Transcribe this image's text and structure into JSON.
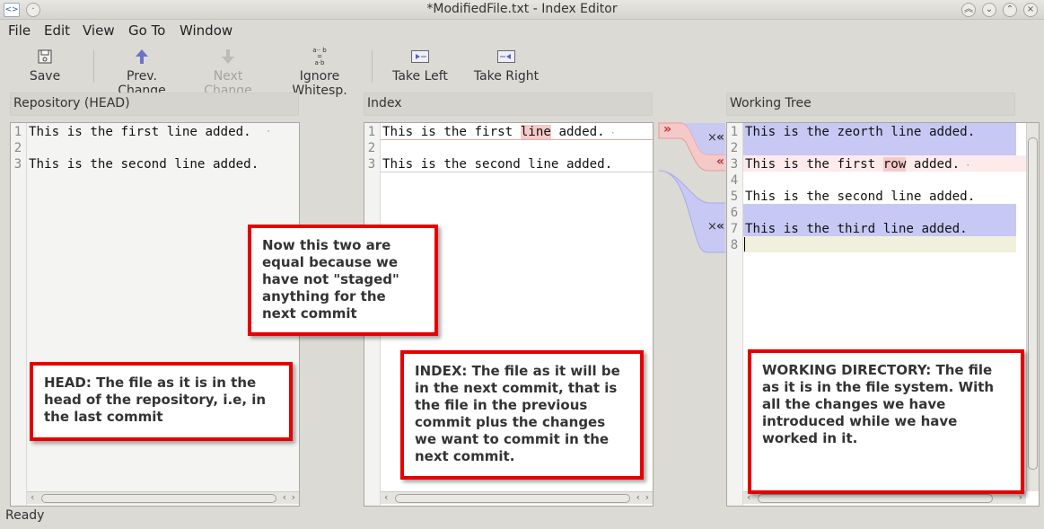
{
  "window": {
    "title": "*ModifiedFile.txt - Index Editor"
  },
  "menu": [
    "File",
    "Edit",
    "View",
    "Go To",
    "Window"
  ],
  "toolbar": {
    "save": "Save",
    "prev_change": "Prev. Change",
    "next_change": "Next Change",
    "ignore_ws": "Ignore Whitesp.",
    "ignore_ws_glyph_top": "a·· b",
    "ignore_ws_glyph_mid": "=",
    "ignore_ws_glyph_bot": "a·b",
    "take_left": "Take Left",
    "take_right": "Take Right"
  },
  "panes": {
    "repository": {
      "header": "Repository (HEAD)",
      "lines": [
        "This is the first line added.",
        "",
        "This is the second line added."
      ],
      "line_numbers": [
        "1",
        "2",
        "3"
      ]
    },
    "index": {
      "header": "Index",
      "line1_pre": "This is the first ",
      "line1_hl": "line",
      "line1_post": " added.",
      "line3": "This is the second line added.",
      "line_numbers": [
        "1",
        "2",
        "3"
      ]
    },
    "working": {
      "header": "Working Tree",
      "line1": "This is the zeorth line added.",
      "line3_pre": "This is the first ",
      "line3_hl": "row",
      "line3_post": " added.",
      "line5": "This is the second line added.",
      "line7": "This is the third line added.",
      "line_numbers": [
        "1",
        "2",
        "3",
        "4",
        "5",
        "6",
        "7",
        "8"
      ]
    }
  },
  "connectors": {
    "take_right_glyph": "»",
    "take_left_glyph": "«",
    "remove_glyph": "×"
  },
  "callouts": {
    "index_equal": "Now this two are equal because we have not \"staged\" anything for the next commit",
    "head": "HEAD: The file as it is in the head of the repository, i.e, in the last commit",
    "index": "INDEX: The file as it will be in the next commit, that is the file in the previous commit plus the changes we want to commit in the next commit.",
    "working": "WORKING DIRECTORY: The file as it is in the file system. With all the changes we have introduced while we have worked in it."
  },
  "status": "Ready",
  "colors": {
    "callout_border": "#e60000",
    "added_bg": "#c7c8f4",
    "changed_bg": "#f6c9c9"
  }
}
